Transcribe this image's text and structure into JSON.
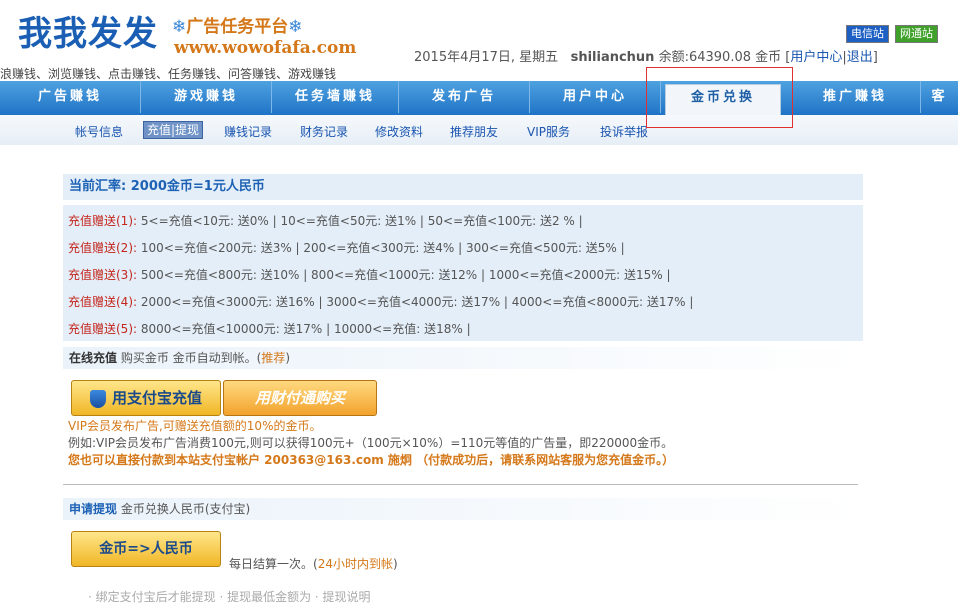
{
  "logo": {
    "title": "我我发发",
    "subtitle": "广告任务平台",
    "flake": "❄",
    "url": "www.wowofafa.com"
  },
  "slogan": "浪赚钱、浏览赚钱、点击赚钱、任务赚钱、问答赚钱、游戏赚钱",
  "site_buttons": {
    "telecom": "电信站",
    "netcom": "网通站"
  },
  "user_bar": {
    "date": "2015年4月17日, 星期五",
    "username": "shilianchun",
    "balance_label": "余额:",
    "balance": "64390.08",
    "unit": "金币",
    "user_center": "用户中心",
    "logout": "退出"
  },
  "nav": [
    "广告赚钱",
    "游戏赚钱",
    "任务墙赚钱",
    "发布广告",
    "用户中心",
    "金币兑换",
    "推广赚钱",
    "客"
  ],
  "subnav": [
    "帐号信息",
    "充值|提现",
    "赚钱记录",
    "财务记录",
    "修改资料",
    "推荐朋友",
    "VIP服务",
    "投诉举报"
  ],
  "rate": "当前汇率: 2000金币=1元人民币",
  "bonus_rows": [
    {
      "label": "充值赠送(1):",
      "text": "5<=充值<10元: 送0% | 10<=充值<50元: 送1% | 50<=充值<100元: 送2 % |"
    },
    {
      "label": "充值赠送(2):",
      "text": "100<=充值<200元: 送3% | 200<=充值<300元: 送4% | 300<=充值<500元: 送5% |"
    },
    {
      "label": "充值赠送(3):",
      "text": "500<=充值<800元: 送10% | 800<=充值<1000元: 送12% | 1000<=充值<2000元: 送15% |"
    },
    {
      "label": "充值赠送(4):",
      "text": "2000<=充值<3000元: 送16% | 3000<=充值<4000元: 送17% | 4000<=充值<8000元: 送17% |"
    },
    {
      "label": "充值赠送(5):",
      "text": "8000<=充值<10000元: 送17% | 10000<=充值: 送18% |"
    }
  ],
  "online": {
    "title": "在线充值",
    "desc": "购买金币 金币自动到帐。(",
    "recommend": "推荐",
    "close": ")"
  },
  "buttons": {
    "alipay": "用支付宝充值",
    "tenpay": "用财付通购买",
    "exchange": "金币=>人民币"
  },
  "vip_note1": "VIP会员发布广告,可赠送充值额的10%的金币。",
  "vip_note2": "例如:VIP会员发布广告消费100元,则可以获得100元+（100元×10%）=110元等值的广告量，即220000金币。",
  "vip_note3": "您也可以直接付款到本站支付宝帐户 200363@163.com 施炯 （付款成功后，请联系网站客服为您充值金币。）",
  "withdraw": {
    "title": "申请提现",
    "desc": "金币兑换人民币(支付宝)"
  },
  "settle": {
    "text": "每日结算一次。(",
    "hl": "24小时内到帐",
    "close": ")"
  },
  "cut_text": "· 绑定支付宝后才能提现 · 提现最低金额为 · 提现说明"
}
